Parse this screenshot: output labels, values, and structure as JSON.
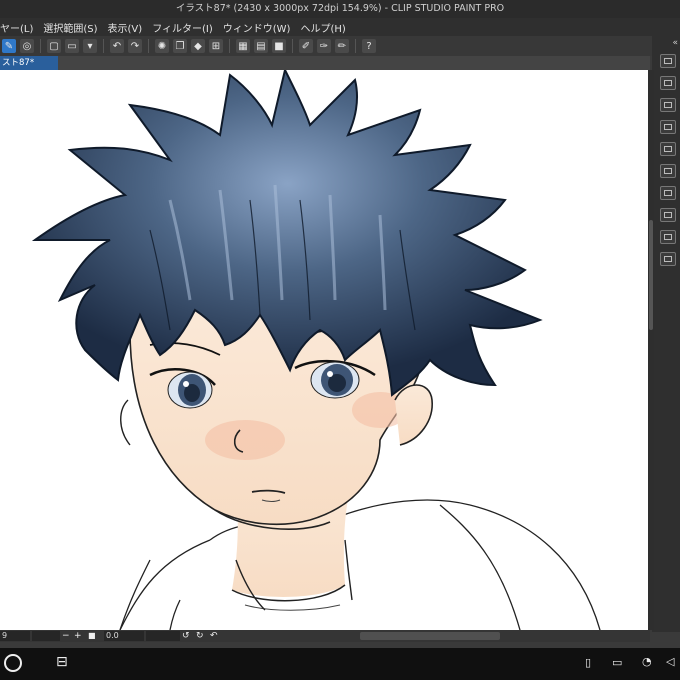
{
  "window": {
    "title": "イラスト87* (2430 x 3000px 72dpi 154.9%) - CLIP STUDIO PAINT PRO"
  },
  "menu": {
    "items": [
      "ヤー(L)",
      "選択範囲(S)",
      "表示(V)",
      "フィルター(I)",
      "ウィンドウ(W)",
      "ヘルプ(H)"
    ]
  },
  "toolbar": {
    "icons": [
      "edit-icon",
      "record-icon",
      "new-file-icon",
      "open-folder-icon",
      "save-icon",
      "undo-icon",
      "redo-icon",
      "loading-icon",
      "copy-icon",
      "fill-icon",
      "transform-icon",
      "grid-icon",
      "layer-icon",
      "pen-icon",
      "brush-icon",
      "pencil-icon",
      "help-icon"
    ]
  },
  "tab": {
    "label": "スト87*"
  },
  "statusbar": {
    "zoom": "9",
    "angle": "0.0"
  },
  "colors": {
    "accent": "#2f78c8",
    "tab": "#2a5f9c",
    "hair": "#243a5a"
  }
}
